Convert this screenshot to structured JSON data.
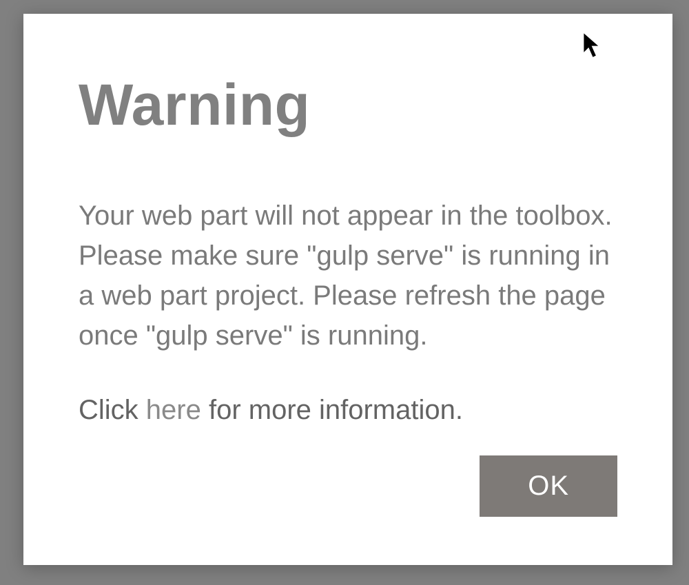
{
  "dialog": {
    "title": "Warning",
    "body": "Your web part will not appear in the toolbox. Please make sure \"gulp serve\" is running in a web part project. Please refresh the page once \"gulp serve\" is running.",
    "info_prefix": "Click ",
    "info_link": "here",
    "info_suffix": " for more information.",
    "ok_label": "OK"
  }
}
